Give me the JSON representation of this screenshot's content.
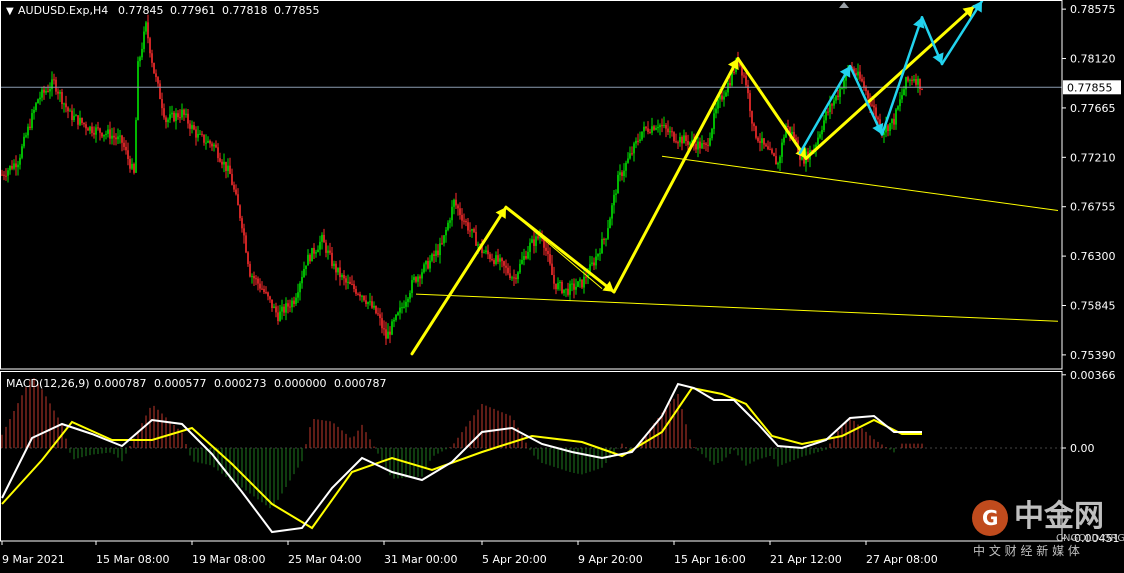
{
  "symbol_header": {
    "symbol_timeframe": "AUDUSD.Exp,H4",
    "ohlc": [
      "0.77845",
      "0.77961",
      "0.77818",
      "0.77855"
    ]
  },
  "colors": {
    "background": "#000000",
    "axis": "#ffffff",
    "bull_candle": "#00e600",
    "bear_candle": "#ff2d2d",
    "trendline": "#ffff00",
    "wave_arrow": "#ffff00",
    "alt_wave": "#22d3ee",
    "macd_line": "#ffffff",
    "signal_line": "#ffff00",
    "hist_positive": "#c0392b",
    "hist_negative": "#1e7a1e"
  },
  "chart_data": [
    {
      "type": "candlestick",
      "title": "AUDUSD.Exp,H4",
      "ylim": [
        0.7526,
        0.7865
      ],
      "y_ticks": [
        "0.78575",
        "0.78120",
        "0.77665",
        "0.77210",
        "0.76755",
        "0.76300",
        "0.75845",
        "0.75390"
      ],
      "current_price": "0.77855",
      "x_ticks": [
        "9 Mar 2021",
        "15 Mar 08:00",
        "19 Mar 08:00",
        "25 Mar 04:00",
        "31 Mar 00:00",
        "5 Apr 20:00",
        "9 Apr 20:00",
        "15 Apr 16:00",
        "21 Apr 12:00",
        "27 Apr 08:00"
      ],
      "close_path_index_price": [
        [
          0,
          0.7705
        ],
        [
          8,
          0.7718
        ],
        [
          18,
          0.7775
        ],
        [
          26,
          0.779
        ],
        [
          34,
          0.776
        ],
        [
          44,
          0.7748
        ],
        [
          54,
          0.7742
        ],
        [
          60,
          0.7735
        ],
        [
          66,
          0.7705
        ],
        [
          68,
          0.7805
        ],
        [
          72,
          0.7842
        ],
        [
          76,
          0.78
        ],
        [
          82,
          0.7755
        ],
        [
          90,
          0.7762
        ],
        [
          98,
          0.774
        ],
        [
          106,
          0.7732
        ],
        [
          114,
          0.7705
        ],
        [
          120,
          0.766
        ],
        [
          124,
          0.7615
        ],
        [
          130,
          0.76
        ],
        [
          138,
          0.7575
        ],
        [
          146,
          0.759
        ],
        [
          152,
          0.7625
        ],
        [
          160,
          0.7645
        ],
        [
          166,
          0.762
        ],
        [
          172,
          0.7605
        ],
        [
          180,
          0.7595
        ],
        [
          188,
          0.7575
        ],
        [
          192,
          0.7555
        ],
        [
          198,
          0.7575
        ],
        [
          206,
          0.7608
        ],
        [
          214,
          0.7625
        ],
        [
          220,
          0.764
        ],
        [
          226,
          0.768
        ],
        [
          232,
          0.766
        ],
        [
          240,
          0.7635
        ],
        [
          248,
          0.7625
        ],
        [
          256,
          0.761
        ],
        [
          264,
          0.764
        ],
        [
          270,
          0.765
        ],
        [
          276,
          0.7605
        ],
        [
          282,
          0.7598
        ],
        [
          290,
          0.7605
        ],
        [
          296,
          0.7625
        ],
        [
          302,
          0.765
        ],
        [
          308,
          0.77
        ],
        [
          314,
          0.7722
        ],
        [
          320,
          0.7745
        ],
        [
          328,
          0.7752
        ],
        [
          336,
          0.774
        ],
        [
          344,
          0.7735
        ],
        [
          352,
          0.773
        ],
        [
          358,
          0.777
        ],
        [
          364,
          0.7792
        ],
        [
          368,
          0.7812
        ],
        [
          372,
          0.779
        ],
        [
          376,
          0.7745
        ],
        [
          382,
          0.7728
        ],
        [
          388,
          0.7715
        ],
        [
          392,
          0.775
        ],
        [
          396,
          0.774
        ],
        [
          400,
          0.7718
        ],
        [
          406,
          0.773
        ],
        [
          412,
          0.776
        ],
        [
          418,
          0.778
        ],
        [
          424,
          0.7805
        ],
        [
          430,
          0.779
        ],
        [
          436,
          0.7765
        ],
        [
          440,
          0.7745
        ],
        [
          446,
          0.7755
        ],
        [
          452,
          0.779
        ],
        [
          456,
          0.7795
        ],
        [
          460,
          0.7786
        ]
      ]
    },
    {
      "type": "line",
      "title": "MACD(12,26,9)",
      "header_values": [
        "0.000787",
        "0.000577",
        "0.000273",
        "0.000000",
        "0.000787"
      ],
      "ylim": [
        -0.00465,
        0.00385
      ],
      "y_ticks": [
        "0.00366",
        "0.00",
        "-0.00451"
      ],
      "series": [
        {
          "name": "MACD",
          "points": [
            [
              0,
              -0.0025
            ],
            [
              15,
              0.0005
            ],
            [
              30,
              0.0012
            ],
            [
              45,
              0.0007
            ],
            [
              60,
              0.0001
            ],
            [
              75,
              0.0014
            ],
            [
              90,
              0.0012
            ],
            [
              105,
              -0.0003
            ],
            [
              120,
              -0.0022
            ],
            [
              135,
              -0.0042
            ],
            [
              150,
              -0.004
            ],
            [
              165,
              -0.002
            ],
            [
              180,
              -0.0005
            ],
            [
              195,
              -0.0012
            ],
            [
              210,
              -0.0016
            ],
            [
              225,
              -0.0007
            ],
            [
              240,
              0.0008
            ],
            [
              255,
              0.001
            ],
            [
              270,
              0.0002
            ],
            [
              285,
              -0.0002
            ],
            [
              300,
              -0.0005
            ],
            [
              315,
              -0.0002
            ],
            [
              330,
              0.0016
            ],
            [
              338,
              0.0032
            ],
            [
              346,
              0.003
            ],
            [
              356,
              0.0024
            ],
            [
              366,
              0.0024
            ],
            [
              378,
              0.0012
            ],
            [
              388,
              0.0001
            ],
            [
              400,
              0.0
            ],
            [
              412,
              0.0004
            ],
            [
              424,
              0.0015
            ],
            [
              436,
              0.0016
            ],
            [
              446,
              0.0008
            ],
            [
              460,
              0.0008
            ]
          ]
        },
        {
          "name": "Signal",
          "points": [
            [
              0,
              -0.0028
            ],
            [
              20,
              -0.0006
            ],
            [
              35,
              0.0013
            ],
            [
              55,
              0.0004
            ],
            [
              75,
              0.0004
            ],
            [
              95,
              0.001
            ],
            [
              115,
              -0.0008
            ],
            [
              135,
              -0.0028
            ],
            [
              155,
              -0.004
            ],
            [
              175,
              -0.0012
            ],
            [
              195,
              -0.0005
            ],
            [
              215,
              -0.0011
            ],
            [
              240,
              -0.0002
            ],
            [
              265,
              0.0006
            ],
            [
              290,
              0.0003
            ],
            [
              310,
              -0.0004
            ],
            [
              330,
              0.0008
            ],
            [
              345,
              0.003
            ],
            [
              360,
              0.0027
            ],
            [
              372,
              0.0022
            ],
            [
              385,
              0.0006
            ],
            [
              400,
              0.0002
            ],
            [
              420,
              0.0006
            ],
            [
              436,
              0.0014
            ],
            [
              450,
              0.0007
            ],
            [
              460,
              0.0007
            ]
          ]
        }
      ],
      "histogram": {
        "name": "OsMA",
        "values_note_x_index_range": [
          0,
          460
        ]
      }
    }
  ],
  "watermark": {
    "brand_cn": "中金网",
    "brand_en": "CNGOLD.ORG",
    "tagline_cn": "中 文 财 经 新 媒 体"
  }
}
